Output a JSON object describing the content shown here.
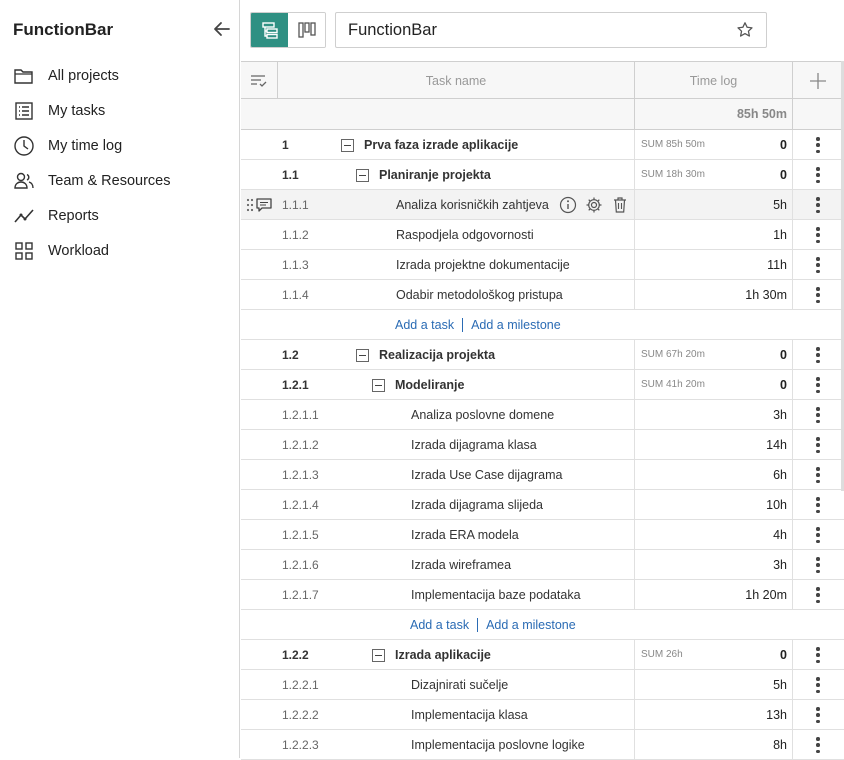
{
  "app": {
    "title": "FunctionBar"
  },
  "sidebar": {
    "items": [
      {
        "label": "All projects",
        "icon": "folder-icon"
      },
      {
        "label": "My tasks",
        "icon": "list-icon"
      },
      {
        "label": "My time log",
        "icon": "clock-icon"
      },
      {
        "label": "Team & Resources",
        "icon": "team-icon"
      },
      {
        "label": "Reports",
        "icon": "chart-line-icon"
      },
      {
        "label": "Workload",
        "icon": "grid-icon"
      }
    ]
  },
  "header": {
    "project_title": "FunctionBar"
  },
  "columns": {
    "task_name": "Task name",
    "time_log": "Time log"
  },
  "total": "85h 50m",
  "add_links": {
    "add_task": "Add a task",
    "add_milestone": "Add a milestone"
  },
  "rows": [
    {
      "num": "1",
      "name": "Prva faza izrade aplikacije",
      "sum": "SUM 85h 50m",
      "val": "0"
    },
    {
      "num": "1.1",
      "name": "Planiranje projekta",
      "sum": "SUM 18h 30m",
      "val": "0"
    },
    {
      "num": "1.1.1",
      "name": "Analiza korisničkih zahtjeva",
      "sum": "",
      "val": "5h"
    },
    {
      "num": "1.1.2",
      "name": "Raspodjela odgovornosti",
      "sum": "",
      "val": "1h"
    },
    {
      "num": "1.1.3",
      "name": "Izrada projektne dokumentacije",
      "sum": "",
      "val": "11h"
    },
    {
      "num": "1.1.4",
      "name": "Odabir metodološkog pristupa",
      "sum": "",
      "val": "1h 30m"
    },
    {
      "num": "1.2",
      "name": "Realizacija projekta",
      "sum": "SUM 67h 20m",
      "val": "0"
    },
    {
      "num": "1.2.1",
      "name": "Modeliranje",
      "sum": "SUM 41h 20m",
      "val": "0"
    },
    {
      "num": "1.2.1.1",
      "name": "Analiza poslovne domene",
      "sum": "",
      "val": "3h"
    },
    {
      "num": "1.2.1.2",
      "name": "Izrada dijagrama klasa",
      "sum": "",
      "val": "14h"
    },
    {
      "num": "1.2.1.3",
      "name": "Izrada Use Case dijagrama",
      "sum": "",
      "val": "6h"
    },
    {
      "num": "1.2.1.4",
      "name": "Izrada dijagrama slijeda",
      "sum": "",
      "val": "10h"
    },
    {
      "num": "1.2.1.5",
      "name": "Izrada ERA modela",
      "sum": "",
      "val": "4h"
    },
    {
      "num": "1.2.1.6",
      "name": "Izrada wireframea",
      "sum": "",
      "val": "3h"
    },
    {
      "num": "1.2.1.7",
      "name": "Implementacija baze podataka",
      "sum": "",
      "val": "1h 20m"
    },
    {
      "num": "1.2.2",
      "name": "Izrada aplikacije",
      "sum": "SUM 26h",
      "val": "0"
    },
    {
      "num": "1.2.2.1",
      "name": "Dizajnirati sučelje",
      "sum": "",
      "val": "5h"
    },
    {
      "num": "1.2.2.2",
      "name": "Implementacija klasa",
      "sum": "",
      "val": "13h"
    },
    {
      "num": "1.2.2.3",
      "name": "Implementacija poslovne logike",
      "sum": "",
      "val": "8h"
    }
  ],
  "colors": {
    "accent": "#2f9083",
    "link": "#2a6bb4"
  }
}
